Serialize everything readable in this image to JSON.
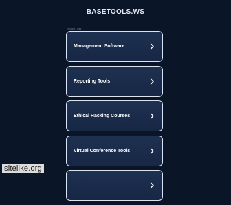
{
  "header": {
    "site_title": "BASETOOLS.WS",
    "related_label": "Related Links"
  },
  "links": [
    {
      "label": "Management Software",
      "icon": "chevron-right-icon"
    },
    {
      "label": "Reporting Tools",
      "icon": "chevron-right-icon"
    },
    {
      "label": "Ethical Hacking Courses",
      "icon": "chevron-right-icon"
    },
    {
      "label": "Virtual Conference Tools",
      "icon": "chevron-right-icon"
    },
    {
      "label": "",
      "icon": "chevron-right-icon"
    }
  ],
  "watermark": {
    "text": "sitelike.org"
  },
  "colors": {
    "background": "#0a1528",
    "card_fill": "#1e3150",
    "card_border": "#dde3ee",
    "text": "#ffffff"
  }
}
